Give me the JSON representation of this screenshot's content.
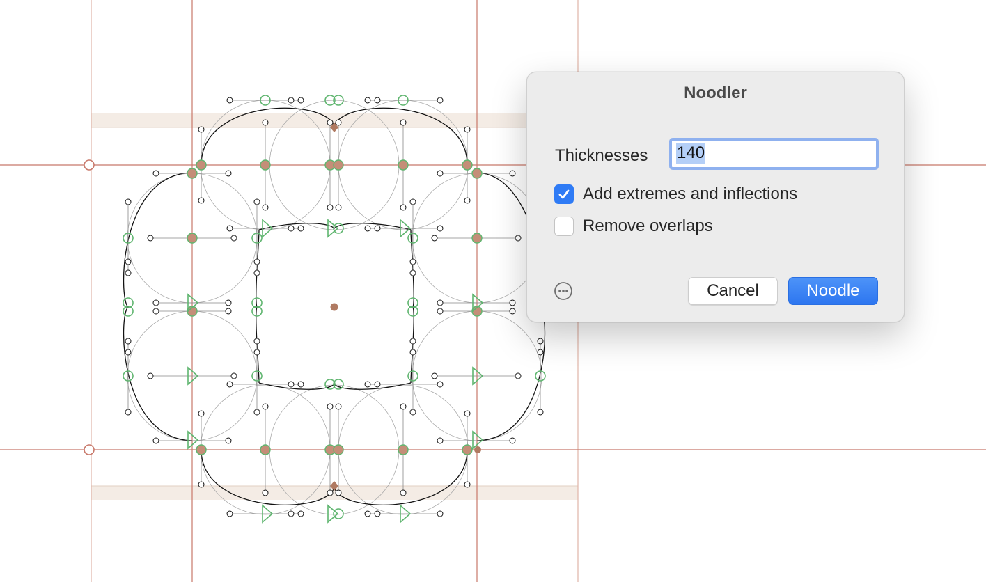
{
  "dialog": {
    "title": "Noodler",
    "thicknesses_label": "Thicknesses",
    "thicknesses_value": "140",
    "add_extremes_label": "Add extremes and inflections",
    "add_extremes_checked": true,
    "remove_overlaps_label": "Remove overlaps",
    "remove_overlaps_checked": false,
    "cancel_label": "Cancel",
    "noodle_label": "Noodle",
    "more_icon": "ellipsis-circle-icon"
  },
  "colors": {
    "accent": "#2f7bf5",
    "guide": "#c8786a",
    "node_green": "#5fb56f",
    "node_fill": "#c48e78",
    "anchor": "#b07a62",
    "metrics_band": "#f4ece5"
  }
}
